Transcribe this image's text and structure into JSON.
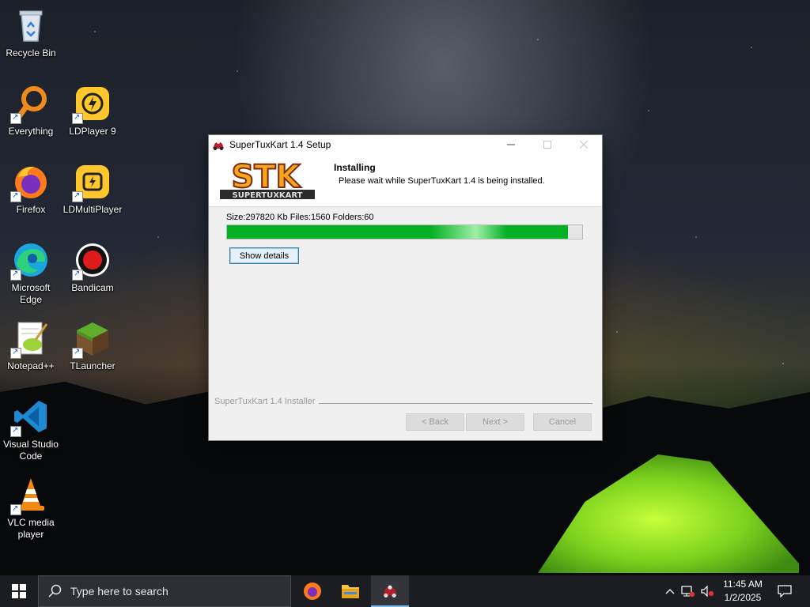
{
  "desktop": {
    "icons": [
      {
        "label": "Recycle Bin"
      },
      {
        "label": "Everything"
      },
      {
        "label": "LDPlayer 9"
      },
      {
        "label": "Firefox"
      },
      {
        "label": "LDMultiPlayer"
      },
      {
        "label": "Microsoft Edge"
      },
      {
        "label": "Bandicam"
      },
      {
        "label": "Notepad++"
      },
      {
        "label": "TLauncher"
      },
      {
        "label": "Visual Studio Code"
      },
      {
        "label": "VLC media player"
      }
    ]
  },
  "installer": {
    "window_title": "SuperTuxKart 1.4 Setup",
    "header_title": "Installing",
    "header_subtitle": "Please wait while SuperTuxKart 1.4 is being installed.",
    "status_text": "Size:297820 Kb  Files:1560  Folders:60",
    "progress_percent": 96,
    "details_button": "Show details",
    "brand_text": "SuperTuxKart 1.4 Installer",
    "back_button": "< Back",
    "next_button": "Next >",
    "cancel_button": "Cancel",
    "logo_text": "STK",
    "logo_subtext": "SUPERTUXKART"
  },
  "taskbar": {
    "search_placeholder": "Type here to search",
    "clock_time": "11:45 AM",
    "clock_date": "1/2/2025"
  },
  "colors": {
    "progress_green": "#06b025",
    "taskbar_bg": "#1b1d22",
    "accent_blue": "#3c7fb1"
  }
}
